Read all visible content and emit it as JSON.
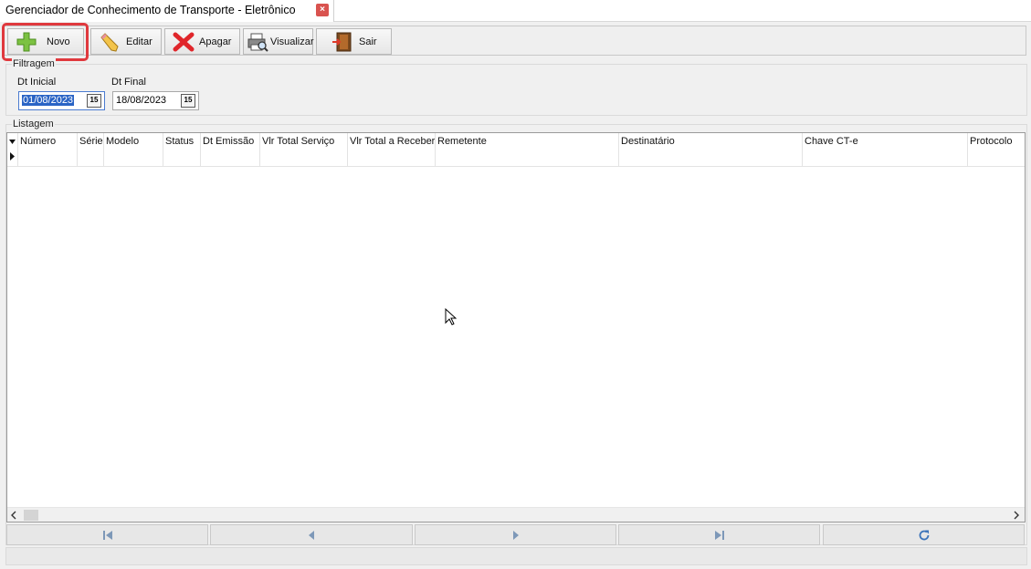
{
  "window": {
    "tab_title": "Gerenciador de Conhecimento de Transporte - Eletrônico",
    "close_glyph": "×"
  },
  "toolbar": {
    "new_label": "Novo",
    "edit_label": "Editar",
    "delete_label": "Apagar",
    "view_label": "Visualizar",
    "exit_label": "Sair"
  },
  "filter": {
    "legend": "Filtragem",
    "start_label": "Dt Inicial",
    "start_value": "01/08/2023",
    "end_label": "Dt Final",
    "end_value": "18/08/2023",
    "calendar_glyph": "15"
  },
  "listing": {
    "legend": "Listagem",
    "columns": [
      "Número",
      "Série",
      "Modelo",
      "Status",
      "Dt Emissão",
      "Vlr Total Serviço",
      "Vlr Total a Receber",
      "Remetente",
      "Destinatário",
      "Chave CT-e",
      "Protocolo"
    ],
    "rows": []
  },
  "icons": {
    "new": "plus-icon",
    "edit": "pencil-icon",
    "delete": "x-icon",
    "view": "printer-preview-icon",
    "exit": "door-exit-icon",
    "first": "first-record-icon",
    "prior": "prior-record-icon",
    "next": "next-record-icon",
    "last": "last-record-icon",
    "refresh": "refresh-icon"
  },
  "colors": {
    "highlight": "#e0393e",
    "selection": "#2a64c5",
    "nav_icon": "#7d98b8",
    "refresh_icon": "#3b73b9"
  }
}
